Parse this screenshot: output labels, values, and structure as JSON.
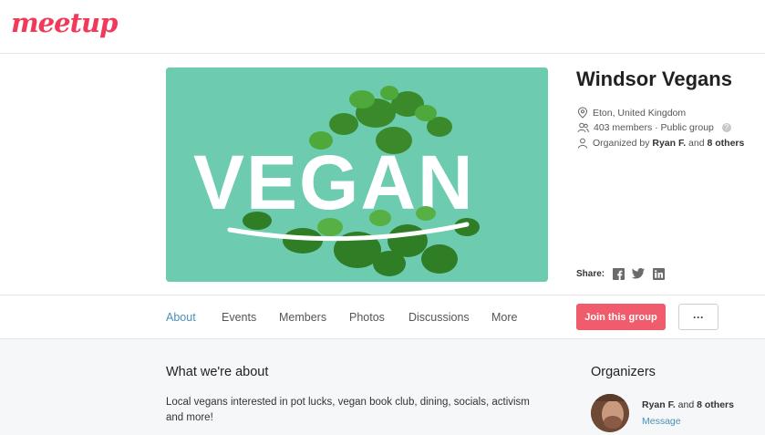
{
  "brand": {
    "logo_text": "meetup",
    "accent": "#f13a59"
  },
  "hero": {
    "overlay_text": "VEGAN",
    "background": "#6dcbb0"
  },
  "group": {
    "title": "Windsor Vegans",
    "location": "Eton, United Kingdom",
    "members": "403 members · Public group",
    "organized_prefix": "Organized by ",
    "organized_name": "Ryan F.",
    "organized_and": " and ",
    "organized_others": "8 others"
  },
  "share": {
    "label": "Share:",
    "icons": [
      "facebook-icon",
      "twitter-icon",
      "linkedin-icon"
    ]
  },
  "nav": {
    "items": [
      {
        "label": "About",
        "active": true
      },
      {
        "label": "Events"
      },
      {
        "label": "Members"
      },
      {
        "label": "Photos"
      },
      {
        "label": "Discussions"
      },
      {
        "label": "More"
      }
    ],
    "join_label": "Join this group",
    "more_label": "···"
  },
  "about": {
    "title": "What we're about",
    "text": "Local vegans interested in pot lucks, vegan book club, dining, socials, activism and more!"
  },
  "organizers": {
    "title": "Organizers",
    "name": "Ryan F.",
    "and": " and ",
    "others": "8 others",
    "message": "Message"
  }
}
